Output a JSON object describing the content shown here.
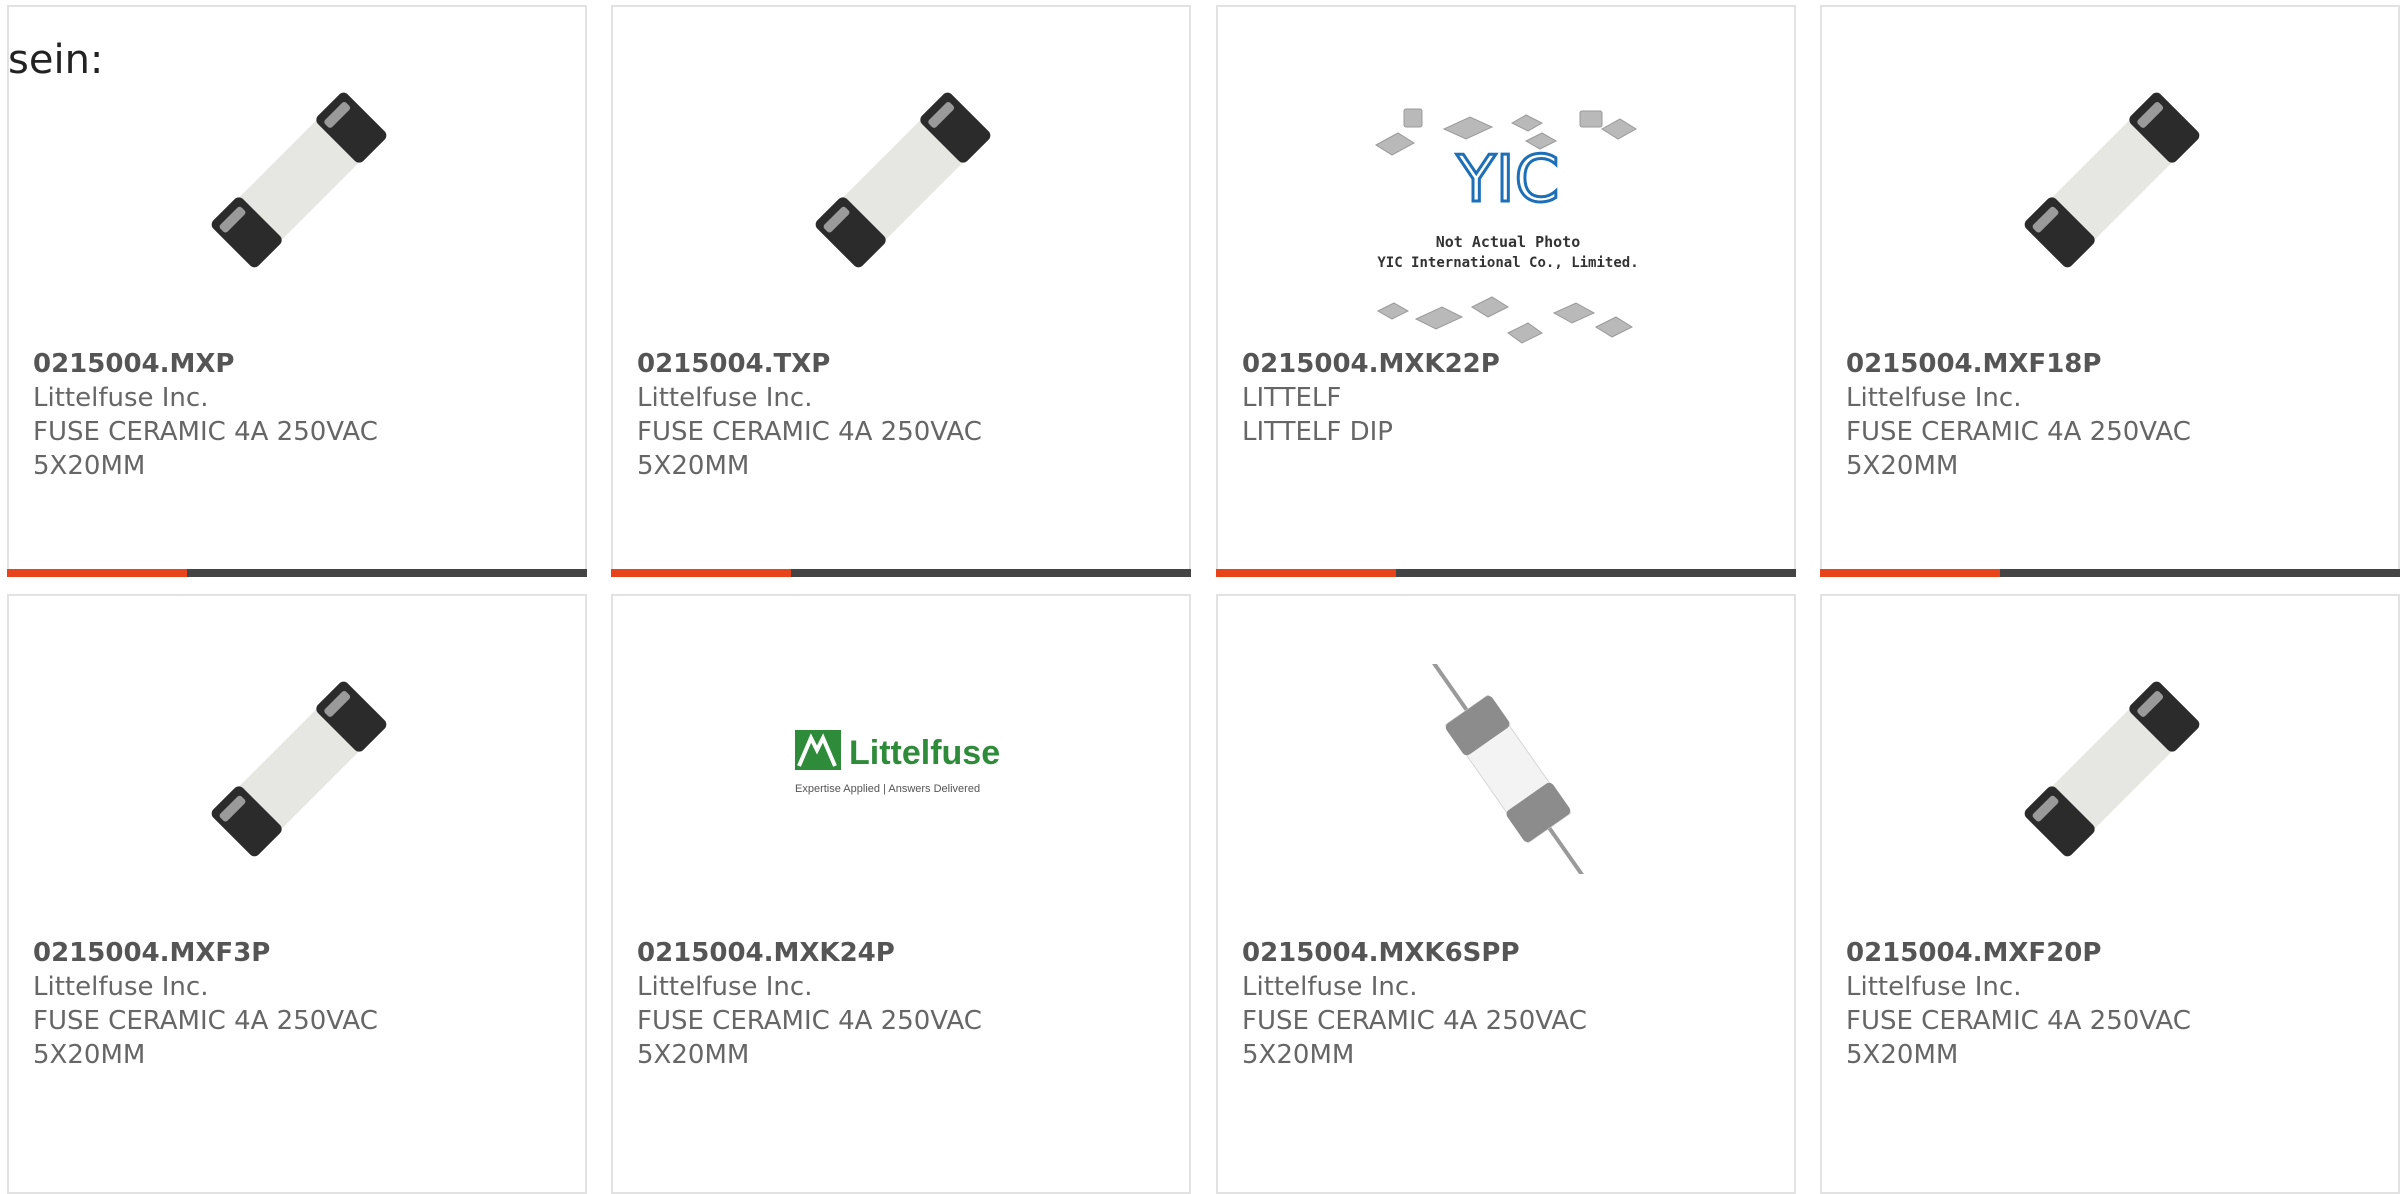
{
  "intro_text": "sein:",
  "colors": {
    "accent": "#e8441b",
    "bar_dark": "#444444",
    "card_border": "#e2e2e2",
    "text": "#555555"
  },
  "products": [
    {
      "part_number": "0215004.MXP",
      "manufacturer": "Littelfuse Inc.",
      "description_line1": "FUSE CERAMIC 4A 250VAC",
      "description_line2": "5X20MM",
      "image_icon": "ceramic-fuse-icon"
    },
    {
      "part_number": "0215004.TXP",
      "manufacturer": "Littelfuse Inc.",
      "description_line1": "FUSE CERAMIC 4A 250VAC",
      "description_line2": "5X20MM",
      "image_icon": "ceramic-fuse-icon"
    },
    {
      "part_number": "0215004.MXK22P",
      "manufacturer": "LITTELF",
      "description_line1": "LITTELF DIP",
      "description_line2": "",
      "image_icon": "not-actual-photo-icon",
      "placeholder_caption_line1": "Not Actual Photo",
      "placeholder_caption_line2": "YIC International Co., Limited.",
      "placeholder_logo": "YIC"
    },
    {
      "part_number": "0215004.MXF18P",
      "manufacturer": "Littelfuse Inc.",
      "description_line1": "FUSE CERAMIC 4A 250VAC",
      "description_line2": "5X20MM",
      "image_icon": "ceramic-fuse-icon"
    },
    {
      "part_number": "0215004.MXF3P",
      "manufacturer": "Littelfuse Inc.",
      "description_line1": "FUSE CERAMIC 4A 250VAC",
      "description_line2": "5X20MM",
      "image_icon": "ceramic-fuse-icon"
    },
    {
      "part_number": "0215004.MXK24P",
      "manufacturer": "Littelfuse Inc.",
      "description_line1": "FUSE CERAMIC 4A 250VAC",
      "description_line2": "5X20MM",
      "image_icon": "littelfuse-logo-icon",
      "logo_text": "Littelfuse",
      "logo_tagline": "Expertise Applied | Answers Delivered"
    },
    {
      "part_number": "0215004.MXK6SPP",
      "manufacturer": "Littelfuse Inc.",
      "description_line1": "FUSE CERAMIC 4A 250VAC",
      "description_line2": "5X20MM",
      "image_icon": "axial-fuse-icon"
    },
    {
      "part_number": "0215004.MXF20P",
      "manufacturer": "Littelfuse Inc.",
      "description_line1": "FUSE CERAMIC 4A 250VAC",
      "description_line2": "5X20MM",
      "image_icon": "ceramic-fuse-icon"
    }
  ],
  "hover_bar_fill_fraction": 0.31
}
